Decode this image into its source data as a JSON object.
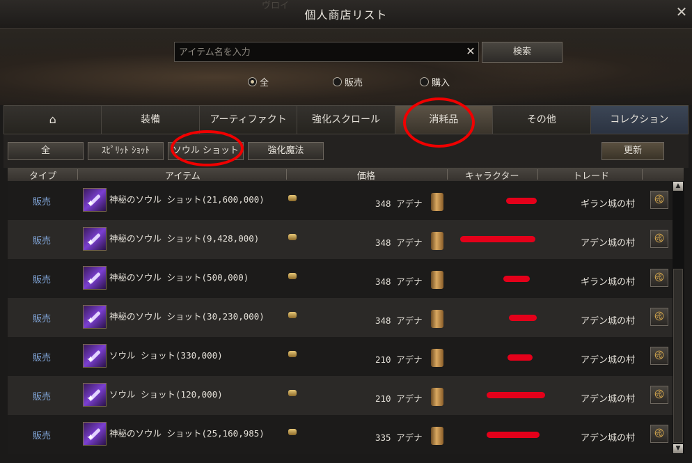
{
  "window": {
    "ghost_text": "ヴロイ",
    "title": "個人商店リスト"
  },
  "search": {
    "placeholder": "アイテム名を入力",
    "button_label": "検索"
  },
  "filter_radios": [
    {
      "label": "全",
      "checked": true
    },
    {
      "label": "販売",
      "checked": false
    },
    {
      "label": "購入",
      "checked": false
    }
  ],
  "tabs": [
    {
      "label": "",
      "icon": "home-icon"
    },
    {
      "label": "装備"
    },
    {
      "label": "アーティファクト"
    },
    {
      "label": "強化スクロール"
    },
    {
      "label": "消耗品",
      "active": true
    },
    {
      "label": "その他"
    },
    {
      "label": "コレクション"
    }
  ],
  "subfilters": [
    {
      "label": "全"
    },
    {
      "label": "ｽﾋﾟﾘｯﾄ ｼｮｯﾄ"
    },
    {
      "label": "ソウル ショット",
      "active": true
    },
    {
      "label": "強化魔法"
    }
  ],
  "refresh_label": "更新",
  "columns": [
    "タイプ",
    "アイテム",
    "価格",
    "キャラクター",
    "トレード"
  ],
  "rows": [
    {
      "type": "販売",
      "item": "神秘のソウル ショット(21,600,000)",
      "price": "348 アデナ",
      "trade": "ギラン城の村"
    },
    {
      "type": "販売",
      "item": "神秘のソウル ショット(9,428,000)",
      "price": "348 アデナ",
      "trade": "アデン城の村"
    },
    {
      "type": "販売",
      "item": "神秘のソウル ショット(500,000)",
      "price": "348 アデナ",
      "trade": "ギラン城の村"
    },
    {
      "type": "販売",
      "item": "神秘のソウル ショット(30,230,000)",
      "price": "348 アデナ",
      "trade": "アデン城の村"
    },
    {
      "type": "販売",
      "item": "ソウル ショット(330,000)",
      "price": "210 アデナ",
      "trade": "アデン城の村"
    },
    {
      "type": "販売",
      "item": "ソウル ショット(120,000)",
      "price": "210 アデナ",
      "trade": "アデン城の村"
    },
    {
      "type": "販売",
      "item": "神秘のソウル ショット(25,160,985)",
      "price": "335 アデナ",
      "trade": "アデン城の村"
    }
  ],
  "colors": {
    "annotation": "#f00000",
    "type_text": "#7fa3d6",
    "redaction": "#e4001a"
  }
}
